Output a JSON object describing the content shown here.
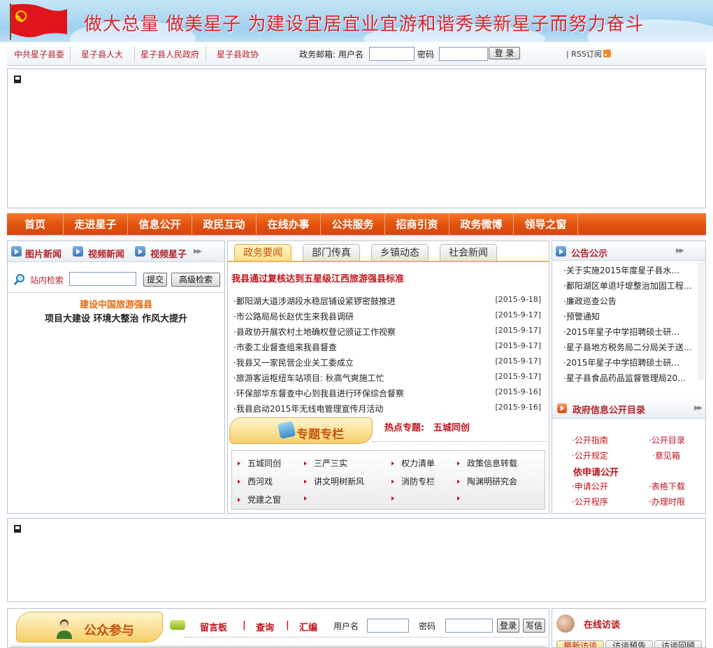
{
  "banner": {
    "slogan": "做大总量 做美星子 为建设宜居宜业宜游和谐秀美新星子而努力奋斗"
  },
  "toplinks": [
    "中共星子县委",
    "星子县人大",
    "星子县人民政府",
    "星子县政协"
  ],
  "mail": {
    "label": "政务邮箱: 用户名",
    "password_label": "密码",
    "login_button": "登 录",
    "rss_label": "| RSS订阅"
  },
  "nav": [
    "首页",
    "走进星子",
    "信息公开",
    "政民互动",
    "在线办事",
    "公共服务",
    "招商引资",
    "政务微博",
    "领导之窗"
  ],
  "left": {
    "tabs": [
      "图片新闻",
      "视频新闻",
      "视频星子"
    ],
    "search_label": "站内检索",
    "submit_button": "提交",
    "advanced_button": "高级检索",
    "tour_line1": "建设中国旅游强县",
    "tour_line2": "项目大建设 环境大整治 作风大提升"
  },
  "middle": {
    "tabs": [
      "政务要闻",
      "部门传真",
      "乡镇动态",
      "社会新闻"
    ],
    "headline": "我县通过复核达到五星级江西旅游强县标准",
    "news": [
      {
        "title": "·鄱阳湖大道涉湖段水稳层铺设紧锣密鼓推进",
        "date": "[2015-9-18]"
      },
      {
        "title": "·市公路局局长赵优生来我县调研",
        "date": "[2015-9-17]"
      },
      {
        "title": "·县政协开展农村土地确权登记颁证工作视察",
        "date": "[2015-9-17]"
      },
      {
        "title": "·市委工业督查组来我县督查",
        "date": "[2015-9-17]"
      },
      {
        "title": "·我县又一家民营企业关工委成立",
        "date": "[2015-9-17]"
      },
      {
        "title": "·旅游客运枢纽车站项目: 秋高气爽施工忙",
        "date": "[2015-9-17]"
      },
      {
        "title": "·环保部华东督查中心到我县进行环保综合督察",
        "date": "[2015-9-16]"
      },
      {
        "title": "·我县启动2015年无线电管理宣传月活动",
        "date": "[2015-9-16]"
      }
    ],
    "special_title": "专题专栏",
    "hot_label": "热点专题:",
    "hot_topic": "五城同创",
    "special_items": [
      "五城同创",
      "三严三实",
      "权力清单",
      "政策信息转载",
      "西河戏",
      "讲文明树新风",
      "消防专栏",
      "陶渊明研究会",
      "党建之窗",
      "",
      "",
      ""
    ]
  },
  "right": {
    "notice_title": "公告公示",
    "notices": [
      "·关于实施2015年度星子县水…",
      "·鄱阳湖区单退圩堤整治加固工程…",
      "·廉政巡查公告",
      "·预警通知",
      "·2015年星子中学招聘硕士研…",
      "·星子县地方税务局二分局关于送…",
      "·2015年星子中学招聘硕士研…",
      "·星子县食品药品监督管理局20…"
    ],
    "catalog_title": "政府信息公开目录",
    "catalog_links": [
      "·公开指南",
      "·公开目录",
      "·公开规定",
      "·意见箱"
    ],
    "apply_label": "依申请公开",
    "apply_links": [
      "·申请公开",
      "·表格下载",
      "·公开程序",
      "·办理时限"
    ]
  },
  "participation": {
    "title": "公众参与",
    "links": [
      "留言板",
      "查询",
      "汇编"
    ],
    "separator": "|",
    "user_label": "用户名",
    "password_label": "密码",
    "login_button": "登录",
    "mail_button": "写信"
  },
  "interview": {
    "title": "在线访谈",
    "tabs": [
      "最新访谈",
      "访谈预告",
      "访谈回顾"
    ]
  }
}
